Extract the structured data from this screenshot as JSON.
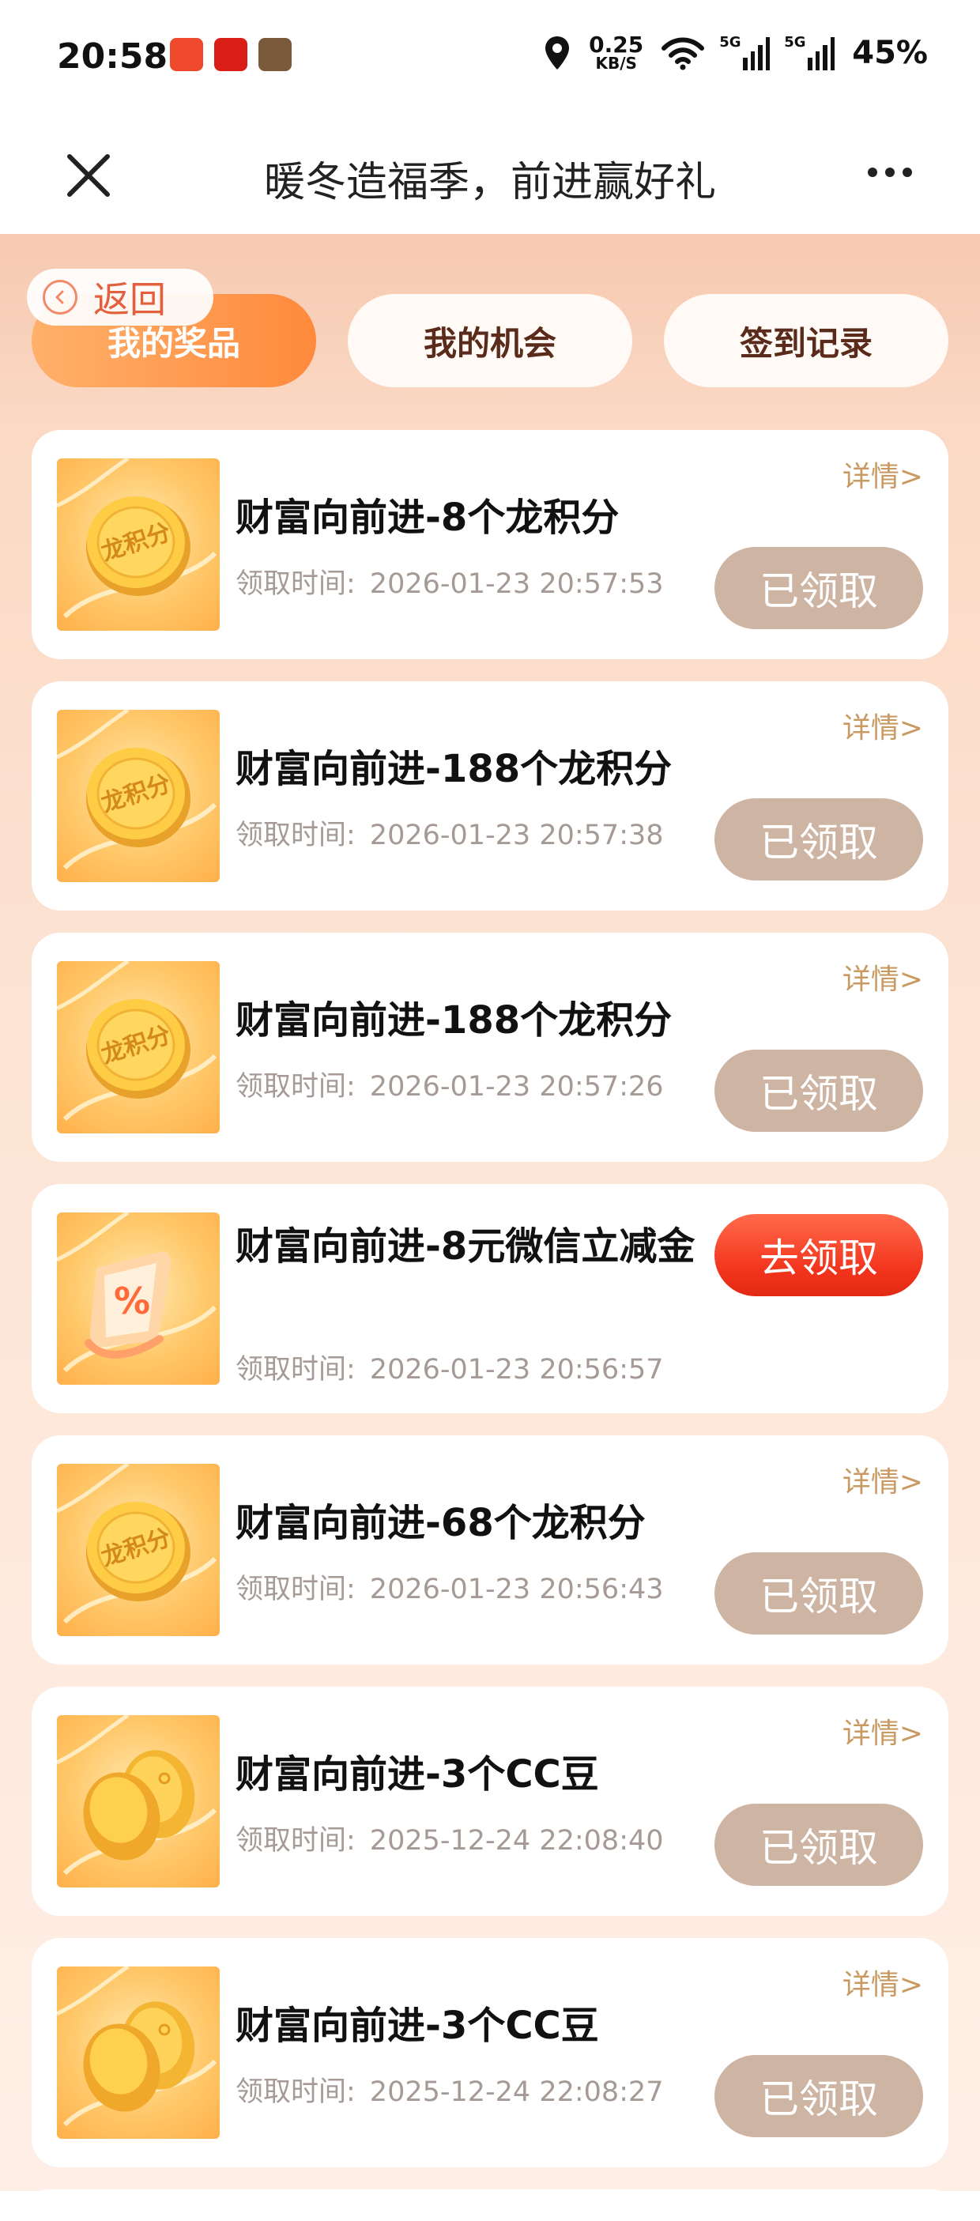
{
  "status_bar": {
    "time": "20:58",
    "net_speed_value": "0.25",
    "net_speed_unit": "KB/S",
    "signal1_tag": "5G",
    "signal2_tag": "5G",
    "battery": "45%",
    "app_icon_colors": [
      "#f04a2e",
      "#d91e18",
      "#7a5a3a"
    ]
  },
  "nav": {
    "title": "暖冬造福季，前进赢好礼",
    "close_icon": "close-icon",
    "more_icon": "more-icon"
  },
  "back": {
    "label": "返回"
  },
  "tabs": [
    {
      "label": "我的奖品",
      "active": true
    },
    {
      "label": "我的机会",
      "active": false
    },
    {
      "label": "签到记录",
      "active": false
    }
  ],
  "cards": [
    {
      "title": "财富向前进-8个龙积分",
      "time_label": "领取时间:",
      "time": "2026-01-23 20:57:53",
      "detail": "详情>",
      "status": "已领取",
      "icon": "coin-icon"
    },
    {
      "title": "财富向前进-188个龙积分",
      "time_label": "领取时间:",
      "time": "2026-01-23 20:57:38",
      "detail": "详情>",
      "status": "已领取",
      "icon": "coin-icon"
    },
    {
      "title": "财富向前进-188个龙积分",
      "time_label": "领取时间:",
      "time": "2026-01-23 20:57:26",
      "detail": "详情>",
      "status": "已领取",
      "icon": "coin-icon"
    },
    {
      "title": "财富向前进-8元微信立减金",
      "time_label": "领取时间:",
      "time": "2026-01-23 20:56:57",
      "detail": "",
      "status": "去领取",
      "icon": "coupon-icon"
    },
    {
      "title": "财富向前进-68个龙积分",
      "time_label": "领取时间:",
      "time": "2026-01-23 20:56:43",
      "detail": "详情>",
      "status": "已领取",
      "icon": "coin-icon"
    },
    {
      "title": "财富向前进-3个CC豆",
      "time_label": "领取时间:",
      "time": "2025-12-24 22:08:40",
      "detail": "详情>",
      "status": "已领取",
      "icon": "bean-icon"
    },
    {
      "title": "财富向前进-3个CC豆",
      "time_label": "领取时间:",
      "time": "2025-12-24 22:08:27",
      "detail": "详情>",
      "status": "已领取",
      "icon": "bean-icon"
    }
  ],
  "coin_text": "龙积分",
  "coupon_text": "%"
}
